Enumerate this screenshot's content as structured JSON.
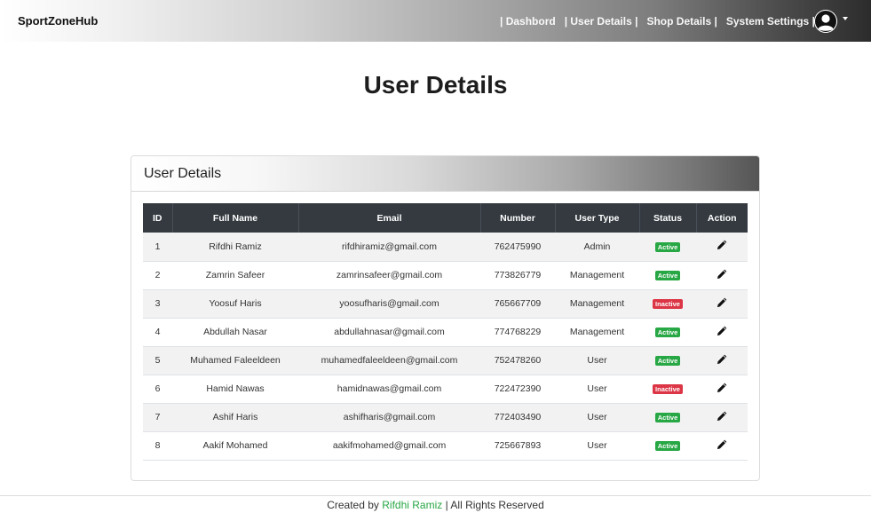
{
  "navbar": {
    "brand": "SportZoneHub",
    "links": [
      {
        "label": "| Dashbord"
      },
      {
        "label": "| User Details |"
      },
      {
        "label": "Shop Details |"
      },
      {
        "label": "System Settings |"
      }
    ],
    "avatar_icon": "user-circle-icon"
  },
  "page": {
    "title": "User Details"
  },
  "card": {
    "title": "User Details"
  },
  "table": {
    "headers": [
      "ID",
      "Full Name",
      "Email",
      "Number",
      "User Type",
      "Status",
      "Action"
    ],
    "rows": [
      {
        "id": "1",
        "name": "Rifdhi Ramiz",
        "email": "rifdhiramiz@gmail.com",
        "number": "762475990",
        "type": "Admin",
        "status": "Active"
      },
      {
        "id": "2",
        "name": "Zamrin Safeer",
        "email": "zamrinsafeer@gmail.com",
        "number": "773826779",
        "type": "Management",
        "status": "Active"
      },
      {
        "id": "3",
        "name": "Yoosuf Haris",
        "email": "yoosufharis@gmail.com",
        "number": "765667709",
        "type": "Management",
        "status": "Inactive"
      },
      {
        "id": "4",
        "name": "Abdullah Nasar",
        "email": "abdullahnasar@gmail.com",
        "number": "774768229",
        "type": "Management",
        "status": "Active"
      },
      {
        "id": "5",
        "name": "Muhamed Faleeldeen",
        "email": "muhamedfaleeldeen@gmail.com",
        "number": "752478260",
        "type": "User",
        "status": "Active"
      },
      {
        "id": "6",
        "name": "Hamid Nawas",
        "email": "hamidnawas@gmail.com",
        "number": "722472390",
        "type": "User",
        "status": "Inactive"
      },
      {
        "id": "7",
        "name": "Ashif Haris",
        "email": "ashifharis@gmail.com",
        "number": "772403490",
        "type": "User",
        "status": "Active"
      },
      {
        "id": "8",
        "name": "Aakif Mohamed",
        "email": "aakifmohamed@gmail.com",
        "number": "725667893",
        "type": "User",
        "status": "Active"
      }
    ],
    "action_icon": "pencil-icon"
  },
  "footer": {
    "prefix": "Created by",
    "author": "Rifdhi Ramiz",
    "suffix": "| All Rights Reserved"
  },
  "colors": {
    "active": "#28a745",
    "inactive": "#dc3545",
    "table_header": "#343a40",
    "author_link": "#28a745"
  }
}
